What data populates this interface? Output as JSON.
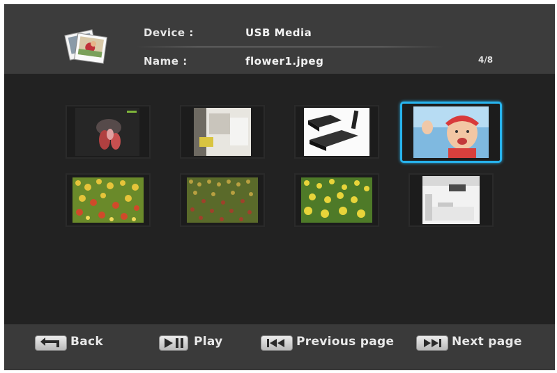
{
  "header": {
    "device_label": "Device :",
    "device_value": "USB Media",
    "name_label": "Name :",
    "name_value": "flower1.jpeg",
    "page_indicator": "4/8",
    "icon": "photos-stack-icon"
  },
  "grid": {
    "thumbnails": [
      {
        "name": "thumb-1",
        "subject": "red flowers on dark background",
        "selected": false
      },
      {
        "name": "thumb-2",
        "subject": "interior room photo",
        "selected": false
      },
      {
        "name": "thumb-3",
        "subject": "black media player devices",
        "selected": false
      },
      {
        "name": "thumb-4",
        "subject": "child with red cap",
        "selected": true
      },
      {
        "name": "thumb-5",
        "subject": "yellow and red tulip field",
        "selected": false
      },
      {
        "name": "thumb-6",
        "subject": "dense flower field",
        "selected": false
      },
      {
        "name": "thumb-7",
        "subject": "yellow flowers field",
        "selected": false
      },
      {
        "name": "thumb-8",
        "subject": "white kitchen interior",
        "selected": false
      }
    ],
    "selection_color": "#27b4ee"
  },
  "footer": {
    "back_label": "Back",
    "back_icon": "return-arrow-icon",
    "play_label": "Play",
    "play_icon": "play-pause-icon",
    "prev_label": "Previous page",
    "prev_icon": "skip-previous-icon",
    "next_label": "Next page",
    "next_icon": "skip-next-icon"
  }
}
